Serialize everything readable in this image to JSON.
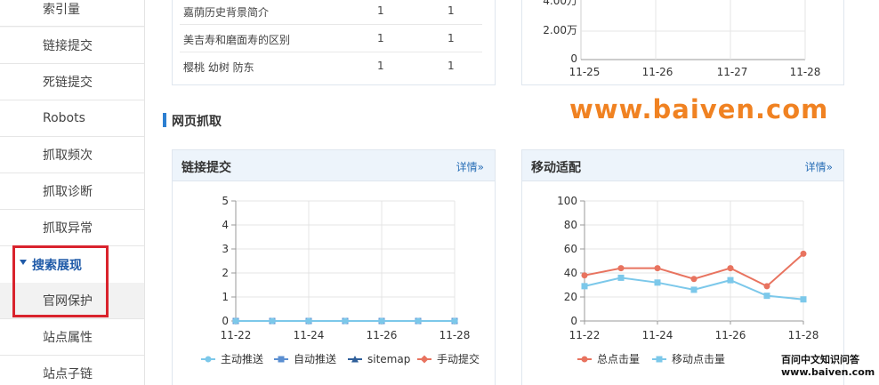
{
  "sidebar": {
    "items": [
      {
        "label": "索引量"
      },
      {
        "label": "链接提交"
      },
      {
        "label": "死链提交"
      },
      {
        "label": "Robots"
      },
      {
        "label": "抓取频次"
      },
      {
        "label": "抓取诊断"
      },
      {
        "label": "抓取异常"
      }
    ],
    "group": {
      "label": "搜索展现"
    },
    "sub_items": [
      {
        "label": "官网保护"
      },
      {
        "label": "站点属性"
      },
      {
        "label": "站点子链"
      }
    ]
  },
  "top_table": {
    "rows": [
      {
        "keyword": "嘉荫历史背景简介",
        "col2": "1",
        "col3": "1"
      },
      {
        "keyword": "美吉寿和磨面寿的区别",
        "col2": "1",
        "col3": "1"
      },
      {
        "keyword": "樱桃 幼树 防东",
        "col2": "1",
        "col3": "1"
      }
    ]
  },
  "top_chart": {
    "ytick_partial": "4.00万",
    "yticks": [
      "2.00万",
      "0"
    ],
    "xticks": [
      "11-25",
      "11-26",
      "11-27",
      "11-28"
    ]
  },
  "section": {
    "title": "网页抓取"
  },
  "watermark": "www.baiven.com",
  "link_submit": {
    "title": "链接提交",
    "link": "详情»",
    "legend": [
      "主动推送",
      "自动推送",
      "sitemap",
      "手动提交"
    ]
  },
  "mobile": {
    "title": "移动适配",
    "link": "详情»",
    "legend": [
      "总点击量",
      "移动点击量"
    ]
  },
  "corner_note": {
    "line1": "百问中文知识问答",
    "line2": "www.baiven.com"
  },
  "colors": {
    "series_blue": "#7cc8ea",
    "series_red": "#e8735f",
    "accent": "#2c7fd1",
    "highlight": "#d9232d"
  },
  "chart_data": [
    {
      "type": "line",
      "title": "链接提交",
      "categories": [
        "11-22",
        "11-23",
        "11-24",
        "11-25",
        "11-26",
        "11-27",
        "11-28"
      ],
      "xticks": [
        "11-22",
        "11-24",
        "11-26",
        "11-28"
      ],
      "ylim": [
        0,
        5
      ],
      "yticks": [
        "0",
        "1",
        "2",
        "3",
        "4",
        "5"
      ],
      "series": [
        {
          "name": "主动推送",
          "values": [
            0,
            0,
            0,
            0,
            0,
            0,
            0
          ]
        },
        {
          "name": "自动推送",
          "values": [
            0,
            0,
            0,
            0,
            0,
            0,
            0
          ]
        },
        {
          "name": "sitemap",
          "values": [
            0,
            0,
            0,
            0,
            0,
            0,
            0
          ]
        },
        {
          "name": "手动提交",
          "values": [
            0,
            0,
            0,
            0,
            0,
            0,
            0
          ]
        }
      ],
      "grid": true,
      "legend": "bottom"
    },
    {
      "type": "line",
      "title": "移动适配",
      "categories": [
        "11-22",
        "11-23",
        "11-24",
        "11-25",
        "11-26",
        "11-27",
        "11-28"
      ],
      "xticks": [
        "11-22",
        "11-24",
        "11-26",
        "11-28"
      ],
      "ylim": [
        0,
        100
      ],
      "yticks": [
        "0",
        "20",
        "40",
        "60",
        "80",
        "100"
      ],
      "series": [
        {
          "name": "总点击量",
          "values": [
            38,
            44,
            44,
            35,
            44,
            29,
            56
          ]
        },
        {
          "name": "移动点击量",
          "values": [
            29,
            36,
            32,
            26,
            34,
            21,
            18
          ]
        }
      ],
      "grid": true,
      "legend": "bottom"
    }
  ]
}
